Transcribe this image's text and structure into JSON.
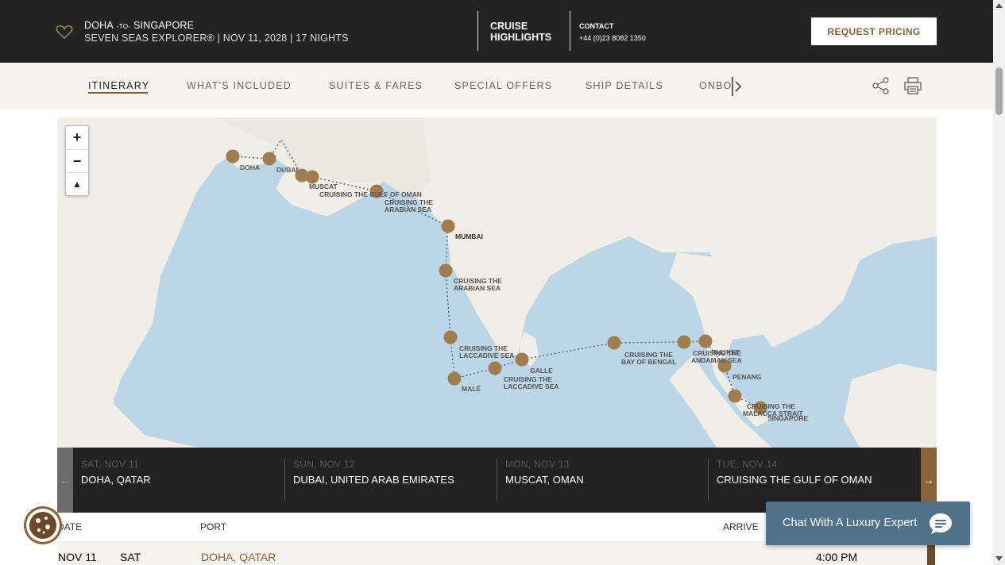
{
  "header": {
    "from": "DOHA",
    "to_word": "-TO-",
    "to": "SINGAPORE",
    "ship_line": "SEVEN SEAS EXPLORER®  |  NOV 11, 2028  |  17 NIGHTS",
    "highlights_line1": "CRUISE",
    "highlights_line2": "HIGHLIGHTS",
    "contact_label": "CONTACT",
    "contact_phone": "+44 (0)23 8082 1350",
    "request_button": "REQUEST PRICING"
  },
  "nav": {
    "tabs": [
      "ITINERARY",
      "WHAT'S INCLUDED",
      "SUITES & FARES",
      "SPECIAL OFFERS",
      "SHIP DETAILS"
    ],
    "overflow_tab": "ONBOARD"
  },
  "map": {
    "zoom_in": "+",
    "zoom_out": "−",
    "compass": "▲",
    "labels": {
      "doha": "DOHA",
      "dubai": "DUBAI",
      "muscat": "MUSCAT",
      "gulf_oman": "CRUISING THE GULF OF OMAN",
      "arabian1_a": "CRUISING THE",
      "arabian1_b": "ARABIAN SEA",
      "mumbai": "MUMBAI",
      "arabian2_a": "CRUISING THE",
      "arabian2_b": "ARABIAN SEA",
      "laccadive1_a": "CRUISING THE",
      "laccadive1_b": "LACCADIVE SEA",
      "male": "MALÉ",
      "galle": "GALLE",
      "laccadive2_a": "CRUISING THE",
      "laccadive2_b": "LACCADIVE SEA",
      "bengal_a": "CRUISING THE",
      "bengal_b": "BAY OF BENGAL",
      "andaman_a": "CRUISING THE",
      "andaman_b": "ANDAMAN SEA",
      "phuket": "PHUKET",
      "penang": "PENANG",
      "malacca_a": "CRUISING THE",
      "malacca_b": "MALACCA STRAIT",
      "singapore": "SINGAPORE"
    }
  },
  "days": [
    {
      "date": "SAT, NOV 11",
      "port": "DOHA, QATAR"
    },
    {
      "date": "SUN, NOV 12",
      "port": "DUBAI, UNITED ARAB EMIRATES"
    },
    {
      "date": "MON, NOV 13",
      "port": "MUSCAT, OMAN"
    },
    {
      "date": "TUE, NOV 14",
      "port": "CRUISING THE GULF OF OMAN"
    }
  ],
  "table": {
    "headers": {
      "date": "DATE",
      "port": "PORT",
      "arrive": "ARRIVE"
    },
    "rows": [
      {
        "date": "NOV 11",
        "day": "SAT",
        "port": "DOHA, QATAR",
        "depart": "4:00 PM"
      }
    ]
  },
  "chat": {
    "label": "Chat With A Luxury Expert"
  },
  "colors": {
    "accent": "#8a6438",
    "dark": "#232323",
    "chat": "#4f7189",
    "sea": "#bcd5e7",
    "land": "#f1eee7"
  }
}
